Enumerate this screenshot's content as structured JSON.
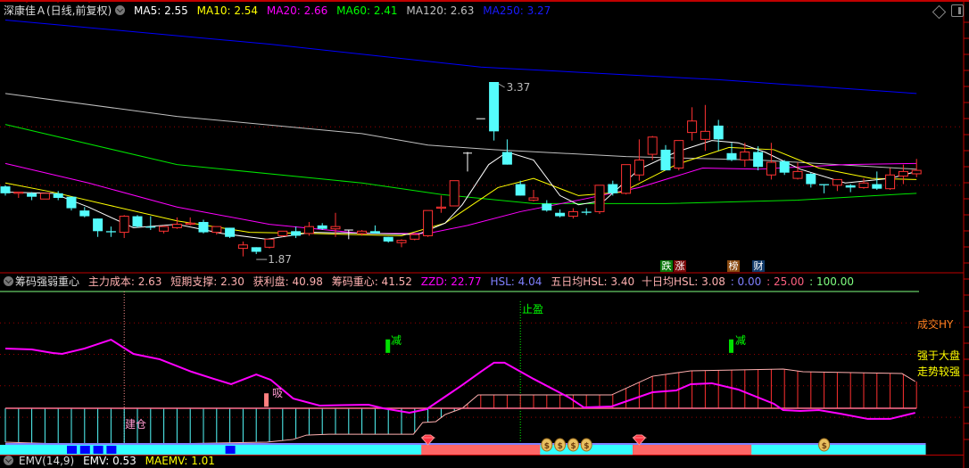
{
  "main_header": {
    "title": "深康佳Ａ(日线,前复权)",
    "ma5": "MA5: 2.55",
    "ma10": "MA10: 2.54",
    "ma20": "MA20: 2.66",
    "ma60": "MA60: 2.41",
    "ma120": "MA120: 2.63",
    "ma250": "MA250: 3.27"
  },
  "sub_header": {
    "title": "筹码强弱重心",
    "main_cost": "主力成本: 2.63",
    "short_support": "短期支撑: 2.30",
    "profit": "获利盘: 40.98",
    "chip_center": "筹码重心: 41.52",
    "zzd": "ZZD: 22.77",
    "hsl": "HSL: 4.04",
    "hsl5": "五日均HSL: 3.40",
    "hsl10": "十日均HSL: 3.08",
    "lvl0": ": 0.00",
    "lvl25": ": 25.00",
    "lvl100": ": 100.00"
  },
  "emv_header": {
    "title": "EMV(14,9)",
    "emv": "EMV: 0.53",
    "maemv": "MAEMV: 1.01"
  },
  "event_tags": [
    {
      "label": "跌",
      "color": "#0a7a0a"
    },
    {
      "label": "涨",
      "color": "#7a0a0a"
    },
    {
      "label": "榜",
      "color": "#8a4a10"
    },
    {
      "label": "财",
      "color": "#103a6a"
    }
  ],
  "annotations": {
    "high_label": "3.37",
    "low_label": "1.87"
  },
  "signals": {
    "jiancang": "建仓",
    "xi": "吸",
    "jian1": "减",
    "jian2": "减",
    "zhiying": "止盈"
  },
  "right_labels": {
    "volume": "成交HY",
    "strong1": "强于大盘",
    "strong2": "走势较强"
  },
  "colors": {
    "up": "#ff3232",
    "down": "#54fcfc",
    "ma5": "#ffffff",
    "ma10": "#ffff00",
    "ma20": "#ff00ff",
    "ma60": "#00e600",
    "ma120": "#c0c0c0",
    "ma250": "#0000ff"
  },
  "chart_data": {
    "type": "candlestick",
    "ylim": [
      1.7,
      3.9
    ],
    "candles": [
      [
        2.46,
        2.47,
        2.38,
        2.4
      ],
      [
        2.4,
        2.41,
        2.36,
        2.41
      ],
      [
        2.4,
        2.41,
        2.34,
        2.37
      ],
      [
        2.35,
        2.4,
        2.35,
        2.4
      ],
      [
        2.4,
        2.42,
        2.34,
        2.36
      ],
      [
        2.37,
        2.37,
        2.25,
        2.27
      ],
      [
        2.25,
        2.28,
        2.19,
        2.2
      ],
      [
        2.18,
        2.18,
        2.02,
        2.07
      ],
      [
        2.07,
        2.11,
        2.02,
        2.06
      ],
      [
        2.06,
        2.21,
        2.01,
        2.2
      ],
      [
        2.2,
        2.21,
        2.1,
        2.11
      ],
      [
        2.11,
        2.2,
        2.08,
        2.1
      ],
      [
        2.07,
        2.12,
        2.05,
        2.11
      ],
      [
        2.1,
        2.19,
        2.09,
        2.13
      ],
      [
        2.13,
        2.19,
        2.12,
        2.14
      ],
      [
        2.15,
        2.17,
        2.05,
        2.06
      ],
      [
        2.06,
        2.11,
        2.04,
        2.11
      ],
      [
        2.1,
        2.1,
        2.01,
        2.02
      ],
      [
        1.92,
        1.98,
        1.85,
        1.95
      ],
      [
        1.93,
        1.93,
        1.87,
        1.89
      ],
      [
        1.93,
        2.0,
        1.92,
        2.0
      ],
      [
        2.03,
        2.07,
        2.02,
        2.07
      ],
      [
        2.07,
        2.11,
        2.01,
        2.03
      ],
      [
        2.05,
        2.15,
        2.03,
        2.11
      ],
      [
        2.12,
        2.14,
        2.08,
        2.09
      ],
      [
        2.09,
        2.23,
        2.02,
        2.11
      ],
      [
        2.08,
        2.08,
        2.0,
        2.08
      ],
      [
        2.05,
        2.08,
        2.03,
        2.07
      ],
      [
        2.07,
        2.12,
        2.05,
        2.05
      ],
      [
        2.02,
        2.02,
        1.97,
        1.98
      ],
      [
        1.97,
        2.0,
        1.93,
        1.99
      ],
      [
        2.0,
        2.05,
        1.99,
        2.04
      ],
      [
        2.03,
        2.25,
        2.02,
        2.25
      ],
      [
        2.27,
        2.38,
        2.23,
        2.28
      ],
      [
        2.29,
        2.51,
        2.29,
        2.51
      ],
      [
        2.75,
        2.76,
        2.59,
        2.75
      ],
      [
        3.05,
        3.05,
        3.05,
        3.05
      ],
      [
        3.37,
        3.37,
        2.86,
        2.94
      ],
      [
        2.76,
        2.87,
        2.65,
        2.65
      ],
      [
        2.48,
        2.51,
        2.38,
        2.38
      ],
      [
        2.34,
        2.43,
        2.33,
        2.36
      ],
      [
        2.31,
        2.34,
        2.24,
        2.25
      ],
      [
        2.23,
        2.26,
        2.19,
        2.2
      ],
      [
        2.2,
        2.27,
        2.18,
        2.24
      ],
      [
        2.24,
        2.27,
        2.21,
        2.23
      ],
      [
        2.24,
        2.47,
        2.22,
        2.47
      ],
      [
        2.48,
        2.51,
        2.38,
        2.4
      ],
      [
        2.4,
        2.65,
        2.39,
        2.65
      ],
      [
        2.56,
        2.87,
        2.51,
        2.69
      ],
      [
        2.74,
        2.9,
        2.69,
        2.89
      ],
      [
        2.78,
        2.82,
        2.6,
        2.6
      ],
      [
        2.62,
        2.86,
        2.6,
        2.86
      ],
      [
        2.93,
        3.15,
        2.86,
        3.03
      ],
      [
        2.87,
        3.17,
        2.77,
        2.94
      ],
      [
        2.99,
        3.04,
        2.77,
        2.87
      ],
      [
        2.75,
        2.84,
        2.68,
        2.69
      ],
      [
        2.69,
        2.84,
        2.63,
        2.76
      ],
      [
        2.76,
        2.81,
        2.6,
        2.63
      ],
      [
        2.56,
        2.84,
        2.52,
        2.67
      ],
      [
        2.68,
        2.69,
        2.56,
        2.58
      ],
      [
        2.53,
        2.67,
        2.52,
        2.59
      ],
      [
        2.57,
        2.58,
        2.45,
        2.48
      ],
      [
        2.48,
        2.48,
        2.4,
        2.47
      ],
      [
        2.47,
        2.52,
        2.42,
        2.52
      ],
      [
        2.47,
        2.48,
        2.41,
        2.45
      ],
      [
        2.45,
        2.53,
        2.44,
        2.49
      ],
      [
        2.48,
        2.59,
        2.43,
        2.44
      ],
      [
        2.44,
        2.62,
        2.43,
        2.56
      ],
      [
        2.55,
        2.65,
        2.48,
        2.59
      ],
      [
        2.57,
        2.7,
        2.54,
        2.6
      ]
    ],
    "ma": {
      "ma250": [
        [
          0,
          3.91
        ],
        [
          20,
          3.7
        ],
        [
          36,
          3.5
        ],
        [
          54,
          3.39
        ],
        [
          69,
          3.27
        ]
      ],
      "ma120": [
        [
          0,
          3.27
        ],
        [
          13,
          3.07
        ],
        [
          27,
          2.92
        ],
        [
          32,
          2.82
        ],
        [
          37,
          2.78
        ],
        [
          47,
          2.72
        ],
        [
          57,
          2.69
        ],
        [
          69,
          2.61
        ]
      ],
      "ma60": [
        [
          0,
          3.0
        ],
        [
          13,
          2.65
        ],
        [
          27,
          2.49
        ],
        [
          33,
          2.39
        ],
        [
          40,
          2.31
        ],
        [
          50,
          2.31
        ],
        [
          60,
          2.34
        ],
        [
          69,
          2.4
        ]
      ],
      "ma20": [
        [
          0,
          2.66
        ],
        [
          6.3,
          2.49
        ],
        [
          13,
          2.28
        ],
        [
          20,
          2.13
        ],
        [
          27,
          2.05
        ],
        [
          32,
          2.05
        ],
        [
          35,
          2.12
        ],
        [
          39,
          2.24
        ],
        [
          43.4,
          2.34
        ],
        [
          48,
          2.45
        ],
        [
          52.8,
          2.62
        ],
        [
          57,
          2.61
        ],
        [
          63.6,
          2.65
        ],
        [
          69,
          2.66
        ]
      ],
      "ma10": [
        [
          0,
          2.49
        ],
        [
          3.6,
          2.41
        ],
        [
          7.7,
          2.3
        ],
        [
          13,
          2.16
        ],
        [
          18.5,
          2.06
        ],
        [
          23.2,
          2.05
        ],
        [
          30,
          2.03
        ],
        [
          33.3,
          2.14
        ],
        [
          37.3,
          2.45
        ],
        [
          40,
          2.53
        ],
        [
          43.4,
          2.38
        ],
        [
          46.7,
          2.41
        ],
        [
          50.8,
          2.65
        ],
        [
          54.8,
          2.8
        ],
        [
          58.2,
          2.78
        ],
        [
          61.6,
          2.62
        ],
        [
          65.6,
          2.53
        ],
        [
          69,
          2.52
        ]
      ],
      "ma5": [
        [
          0,
          2.41
        ],
        [
          3.6,
          2.4
        ],
        [
          6.3,
          2.28
        ],
        [
          9.7,
          2.1
        ],
        [
          13,
          2.13
        ],
        [
          16.4,
          2.05
        ],
        [
          19.8,
          2.0
        ],
        [
          23.2,
          2.06
        ],
        [
          27.9,
          2.05
        ],
        [
          31.2,
          2.04
        ],
        [
          33.3,
          2.14
        ],
        [
          34.6,
          2.3
        ],
        [
          36.6,
          2.65
        ],
        [
          38,
          2.76
        ],
        [
          40,
          2.69
        ],
        [
          42,
          2.38
        ],
        [
          43.4,
          2.3
        ],
        [
          45.4,
          2.34
        ],
        [
          48,
          2.61
        ],
        [
          50.8,
          2.76
        ],
        [
          53.5,
          2.86
        ],
        [
          55.5,
          2.84
        ],
        [
          57.5,
          2.76
        ],
        [
          60.2,
          2.61
        ],
        [
          63.6,
          2.49
        ],
        [
          67,
          2.53
        ],
        [
          69,
          2.59
        ]
      ]
    },
    "indicator": {
      "ylim": [
        0,
        100
      ],
      "baseline": 25,
      "gridlines": [
        100,
        82,
        61,
        40,
        19
      ],
      "zzd_line": [
        [
          0,
          64.9
        ],
        [
          2,
          64.3
        ],
        [
          3.6,
          61.9
        ],
        [
          4.3,
          61.3
        ],
        [
          6,
          64.9
        ],
        [
          8,
          70.8
        ],
        [
          9.7,
          61.3
        ],
        [
          11.7,
          57.7
        ],
        [
          14.1,
          49.4
        ],
        [
          15.8,
          44.6
        ],
        [
          17.1,
          41.1
        ],
        [
          19,
          47.6
        ],
        [
          20.1,
          44
        ],
        [
          21.8,
          31.5
        ],
        [
          23.8,
          26.8
        ],
        [
          27.5,
          27.4
        ],
        [
          28.6,
          25
        ],
        [
          30.6,
          22
        ],
        [
          31.9,
          24.4
        ],
        [
          34.6,
          40.5
        ],
        [
          36,
          49.4
        ],
        [
          37,
          55.4
        ],
        [
          37.8,
          55.4
        ],
        [
          40,
          44.6
        ],
        [
          42.7,
          32.1
        ],
        [
          43.8,
          25.6
        ],
        [
          45.9,
          26.2
        ],
        [
          49,
          35.7
        ],
        [
          50.8,
          36.9
        ],
        [
          51.9,
          41.1
        ],
        [
          53.5,
          41.7
        ],
        [
          55.5,
          37.5
        ],
        [
          58.2,
          28
        ],
        [
          58.9,
          23.8
        ],
        [
          60.2,
          23.2
        ],
        [
          61.6,
          23.8
        ],
        [
          63.2,
          21.4
        ],
        [
          65.3,
          17.9
        ],
        [
          67,
          17.9
        ],
        [
          68.9,
          22
        ]
      ],
      "band_edge": [
        [
          0,
          2.4
        ],
        [
          4.3,
          1.2
        ],
        [
          12.4,
          1.2
        ],
        [
          19.8,
          2.4
        ],
        [
          21.8,
          4.2
        ],
        [
          22.8,
          7.1
        ],
        [
          24.5,
          7.7
        ],
        [
          30.9,
          7.7
        ],
        [
          31.6,
          15.5
        ],
        [
          32.6,
          16.1
        ],
        [
          33.3,
          20.8
        ],
        [
          34.6,
          25
        ],
        [
          35.8,
          33.9
        ],
        [
          45.9,
          33.9
        ],
        [
          49,
          46.4
        ],
        [
          51.9,
          50
        ],
        [
          58.9,
          51.2
        ],
        [
          60.4,
          49.4
        ],
        [
          67.9,
          48.2
        ],
        [
          68.9,
          42.9
        ]
      ],
      "xi_bar": {
        "index": 19.8,
        "range": [
          26,
          35
        ]
      },
      "jian_bars": [
        {
          "index": 29,
          "range": [
            62,
            71
          ]
        },
        {
          "index": 55,
          "range": [
            62,
            71
          ]
        }
      ],
      "jiancang_index": 9,
      "zhiying_index": 39
    },
    "strip": {
      "salmon_ranges": [
        [
          31.5,
          40.5
        ],
        [
          47.5,
          56.5
        ]
      ],
      "end_index": 69.7,
      "blue_squares": [
        5,
        6,
        7,
        8,
        17
      ],
      "money_bags": [
        41,
        42,
        43,
        44,
        62
      ],
      "diamonds": [
        32,
        48
      ]
    }
  }
}
